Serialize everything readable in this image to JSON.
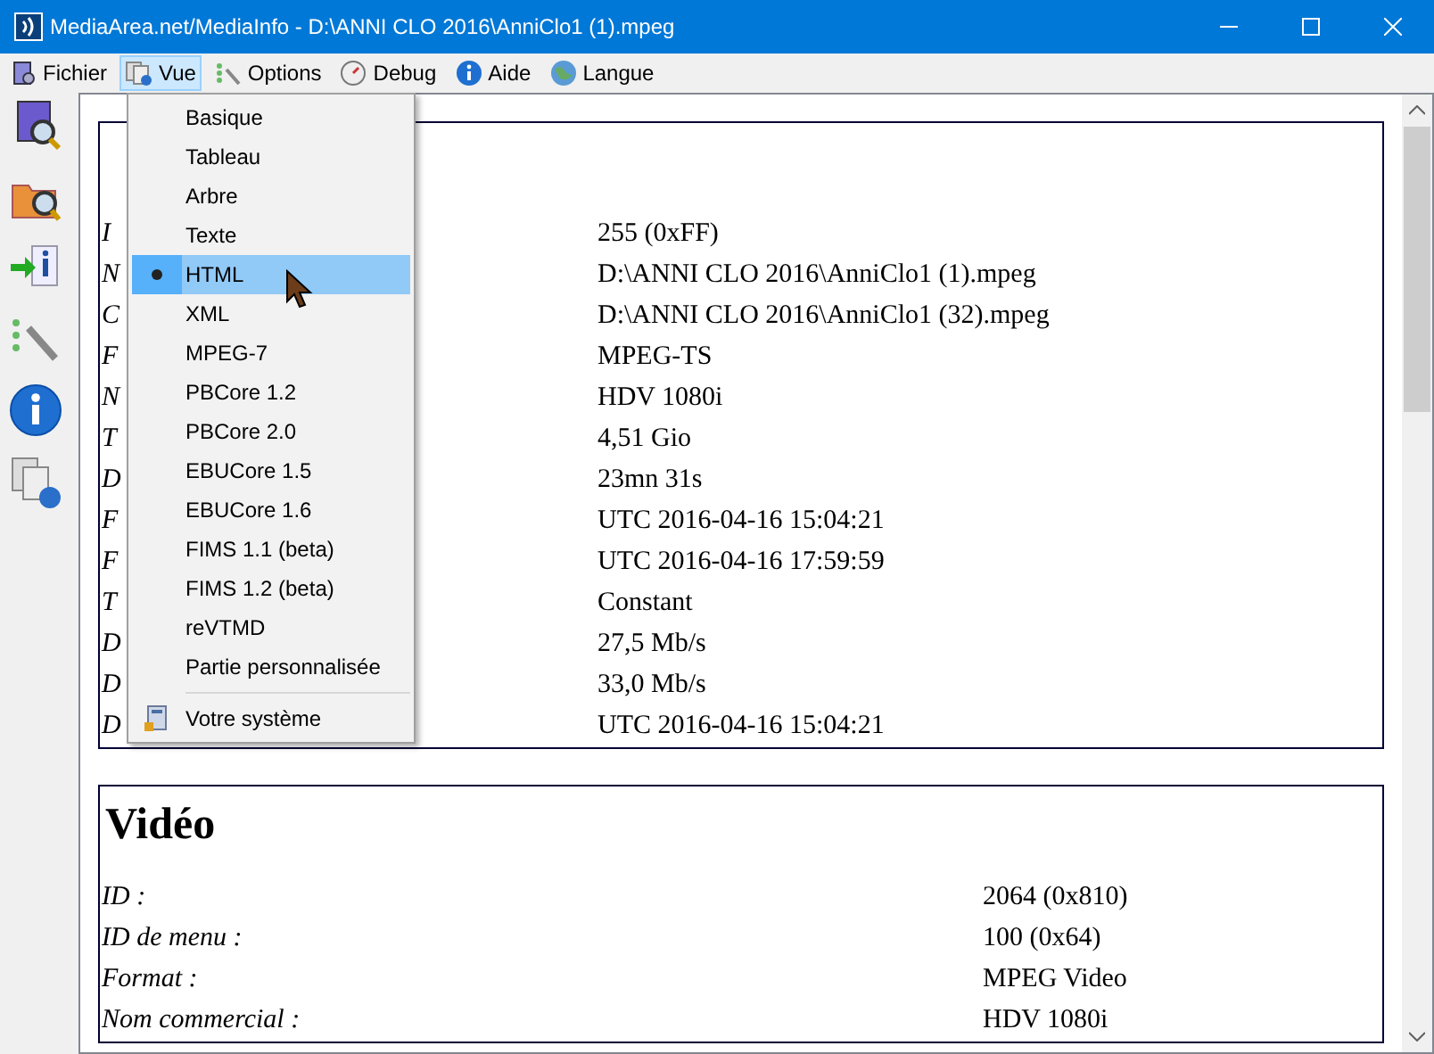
{
  "window": {
    "title": "MediaArea.net/MediaInfo - D:\\ANNI CLO 2016\\AnniClo1 (1).mpeg"
  },
  "menu_bar": [
    {
      "label": "Fichier",
      "selected": false
    },
    {
      "label": "Vue",
      "selected": true
    },
    {
      "label": "Options",
      "selected": false
    },
    {
      "label": "Debug",
      "selected": false
    },
    {
      "label": "Aide",
      "selected": false
    },
    {
      "label": "Langue",
      "selected": false
    }
  ],
  "view_menu": {
    "items": [
      {
        "label": "Basique",
        "selected": false,
        "highlighted": false
      },
      {
        "label": "Tableau",
        "selected": false,
        "highlighted": false
      },
      {
        "label": "Arbre",
        "selected": false,
        "highlighted": false
      },
      {
        "label": "Texte",
        "selected": false,
        "highlighted": false
      },
      {
        "label": "HTML",
        "selected": true,
        "highlighted": true
      },
      {
        "label": "XML",
        "selected": false,
        "highlighted": false
      },
      {
        "label": "MPEG-7",
        "selected": false,
        "highlighted": false
      },
      {
        "label": "PBCore 1.2",
        "selected": false,
        "highlighted": false
      },
      {
        "label": "PBCore 2.0",
        "selected": false,
        "highlighted": false
      },
      {
        "label": "EBUCore 1.5",
        "selected": false,
        "highlighted": false
      },
      {
        "label": "EBUCore 1.6",
        "selected": false,
        "highlighted": false
      },
      {
        "label": "FIMS 1.1 (beta)",
        "selected": false,
        "highlighted": false
      },
      {
        "label": "FIMS 1.2 (beta)",
        "selected": false,
        "highlighted": false
      },
      {
        "label": "reVTMD",
        "selected": false,
        "highlighted": false
      },
      {
        "label": "Partie personnalisée",
        "selected": false,
        "highlighted": false
      }
    ],
    "footer_item": {
      "label": "Votre système"
    }
  },
  "sections": [
    {
      "rows": [
        {
          "label": "I",
          "value": "255 (0xFF)"
        },
        {
          "label": "N",
          "value": "D:\\ANNI CLO 2016\\AnniClo1 (1).mpeg"
        },
        {
          "label": "C",
          "value": "D:\\ANNI CLO 2016\\AnniClo1 (32).mpeg"
        },
        {
          "label": "F",
          "value": "MPEG-TS"
        },
        {
          "label": "N",
          "value": "HDV 1080i"
        },
        {
          "label": "T",
          "value": "4,51 Gio"
        },
        {
          "label": "D",
          "value": "23mn 31s"
        },
        {
          "label": "F",
          "value": "UTC 2016-04-16 15:04:21"
        },
        {
          "label": "F",
          "value": "UTC 2016-04-16 17:59:59"
        },
        {
          "label": "T",
          "value": "Constant"
        },
        {
          "label": "D",
          "value": "27,5 Mb/s"
        },
        {
          "label": "D",
          "value": "33,0 Mb/s"
        },
        {
          "label": "D",
          "value": "UTC 2016-04-16 15:04:21"
        }
      ]
    },
    {
      "title": "Vidéo",
      "rows": [
        {
          "label": "ID :",
          "value": "2064 (0x810)"
        },
        {
          "label": "ID de menu :",
          "value": "100 (0x64)"
        },
        {
          "label": "Format :",
          "value": "MPEG Video"
        },
        {
          "label": "Nom commercial :",
          "value": "HDV 1080i"
        }
      ]
    }
  ]
}
